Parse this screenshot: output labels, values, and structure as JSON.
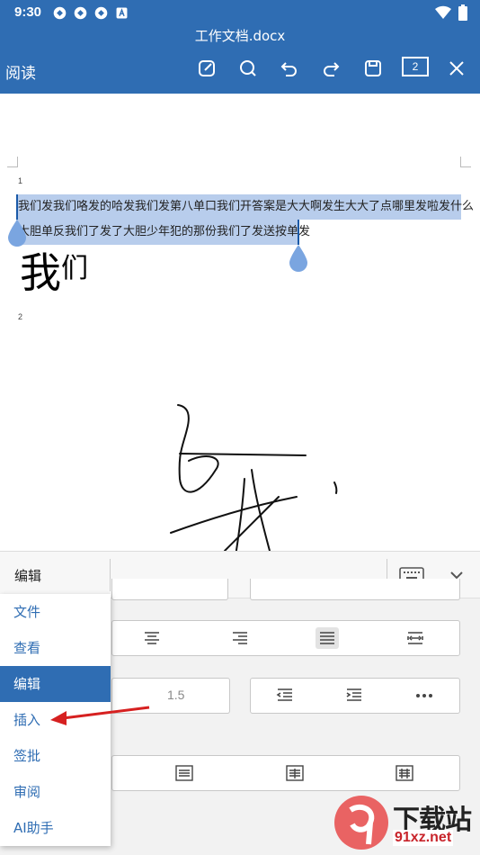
{
  "status": {
    "time": "9:30"
  },
  "header": {
    "doc_title": "工作文档.docx",
    "mode": "阅读",
    "page_count": "2"
  },
  "document": {
    "page1_number": "1",
    "page2_number": "2",
    "selected_line1": "我们发我们咯发的哈发我们发第八单口我们开答案是大大啊发生大大了点哪里发啦发什么",
    "selected_line2": "大胆单反我们了发了大胆少年犯的那份我们了发送按单发",
    "big_text_main": "我",
    "big_text_small": "们"
  },
  "panel": {
    "title": "编辑",
    "line_spacing_value": "1.5"
  },
  "menu": {
    "items": [
      {
        "label": "文件"
      },
      {
        "label": "查看"
      },
      {
        "label": "编辑"
      },
      {
        "label": "插入"
      },
      {
        "label": "签批"
      },
      {
        "label": "审阅"
      },
      {
        "label": "AI助手"
      }
    ],
    "active": "编辑"
  },
  "watermark": {
    "title": "下载站",
    "site": "91xz.net"
  },
  "colors": {
    "header_blue": "#2f6db3",
    "selection": "#b8cdec",
    "arrow_red": "#d62020"
  }
}
